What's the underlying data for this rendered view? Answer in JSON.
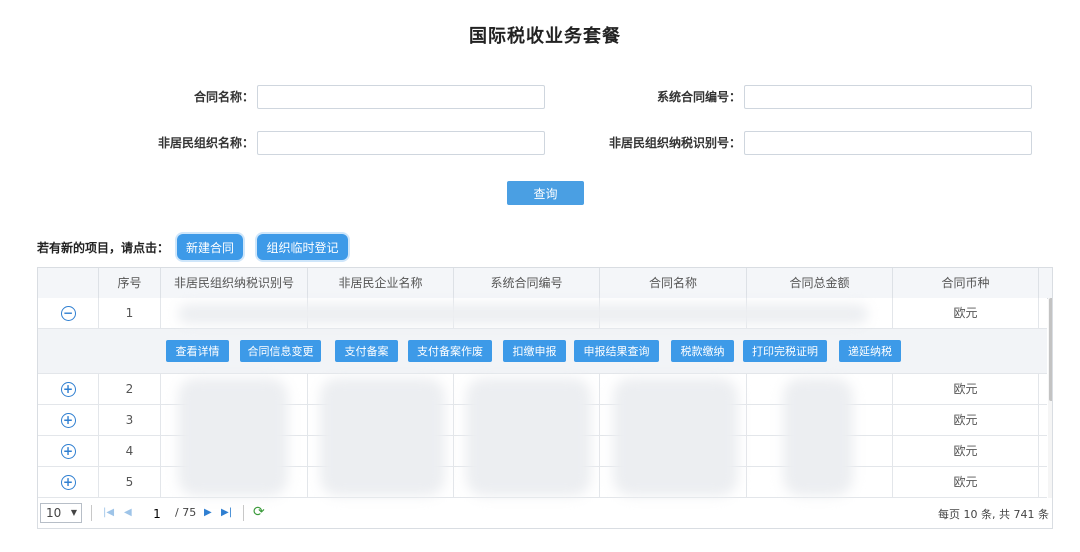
{
  "page_title": "国际税收业务套餐",
  "form": {
    "contract_name_label": "合同名称：",
    "system_contract_no_label": "系统合同编号：",
    "nonresident_org_name_label": "非居民组织名称：",
    "nonresident_tax_id_label": "非居民组织纳税识别号：",
    "contract_name_value": "",
    "system_contract_no_value": "",
    "nonresident_org_name_value": "",
    "nonresident_tax_id_value": "",
    "query_button": "查询"
  },
  "new_project": {
    "prompt": "若有新的项目，请点击：",
    "new_contract_button": "新建合同",
    "temp_register_button": "组织临时登记"
  },
  "table": {
    "columns": [
      "序号",
      "非居民组织纳税识别号",
      "非居民企业名称",
      "系统合同编号",
      "合同名称",
      "合同总金额",
      "合同币种"
    ],
    "rows": [
      {
        "index": "1",
        "currency": "欧元",
        "expanded": true
      },
      {
        "index": "2",
        "currency": "欧元",
        "expanded": false
      },
      {
        "index": "3",
        "currency": "欧元",
        "expanded": false
      },
      {
        "index": "4",
        "currency": "欧元",
        "expanded": false
      },
      {
        "index": "5",
        "currency": "欧元",
        "expanded": false
      }
    ],
    "actions": [
      "查看详情",
      "合同信息变更",
      "支付备案",
      "支付备案作废",
      "扣缴申报",
      "申报结果查询",
      "税款缴纳",
      "打印完税证明",
      "递延纳税"
    ],
    "icons": {
      "collapse": "minus-circle-icon",
      "expand": "plus-circle-icon"
    }
  },
  "pager": {
    "page_size": "10",
    "current_page": "1",
    "total_pages": "/ 75",
    "summary": "每页 10 条, 共 741 条"
  },
  "colors": {
    "accent": "#3d9ae8",
    "icon_blue": "#2f7fd1"
  }
}
